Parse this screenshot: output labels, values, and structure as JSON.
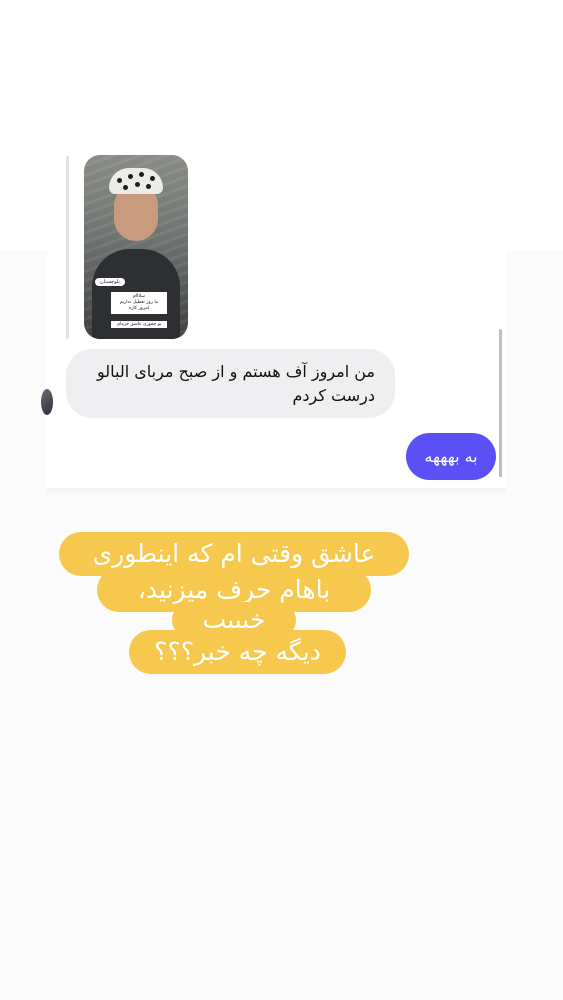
{
  "chat": {
    "story_reply": {
      "location_tag": "بلوچستان",
      "caption": "سلااام\nما روز تعطیل نداریم\nامروز کاره",
      "question_prompt": "تو چجوری عاشق خرمای"
    },
    "incoming_message": "من امروز آف هستم و از صبح مربای البالو درست کردم",
    "outgoing_message": "به بهههه"
  },
  "sticker": {
    "lines": [
      "عاشق وقتی ام که اینطوری",
      "باهام حرف میزنید،",
      "خبببب",
      "دیگه چه خبر؟؟؟"
    ]
  },
  "colors": {
    "outgoing_bubble": "#5b50f6",
    "incoming_bubble": "#efeff1",
    "sticker_background": "#f7c84e"
  }
}
